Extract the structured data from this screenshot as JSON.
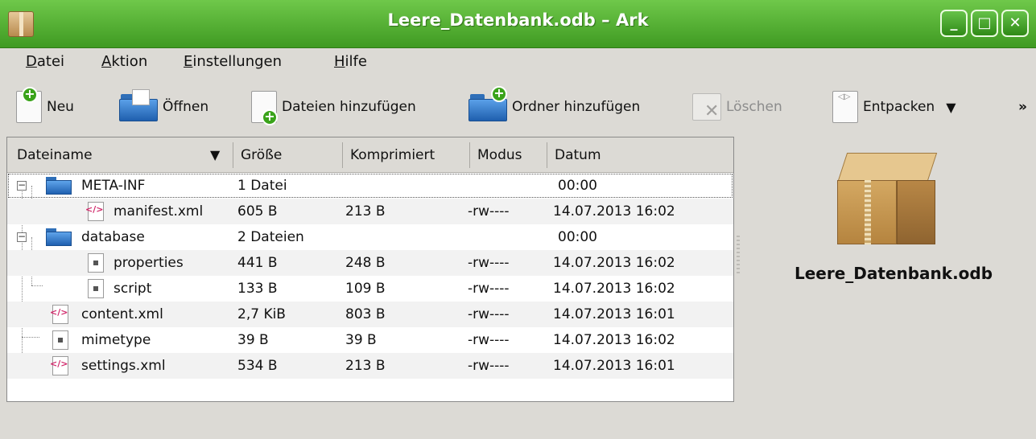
{
  "window": {
    "title": "Leere_Datenbank.odb – Ark",
    "icon": "ark-package-icon",
    "buttons": [
      "minimize-button",
      "maximize-button",
      "close-button"
    ]
  },
  "menubar": {
    "items": [
      {
        "label": "Datei",
        "mnemonic": "D",
        "rest": "atei"
      },
      {
        "label": "Aktion",
        "mnemonic": "A",
        "rest": "ktion"
      },
      {
        "label": "Einstellungen",
        "mnemonic": "E",
        "rest": "instellungen"
      },
      {
        "label": "Hilfe",
        "mnemonic": "H",
        "rest": "ilfe"
      }
    ]
  },
  "toolbar": {
    "neu": "Neu",
    "oeffnen": "Öffnen",
    "dateien_hinzufuegen": "Dateien hinzufügen",
    "ordner_hinzufuegen": "Ordner hinzufügen",
    "loeschen": "Löschen",
    "entpacken": "Entpacken",
    "more": "»"
  },
  "table": {
    "columns": [
      "Dateiname",
      "Größe",
      "Komprimiert",
      "Modus",
      "Datum"
    ],
    "rows": [
      {
        "name": "META-INF",
        "size": "1 Datei",
        "compressed": "",
        "mode": "",
        "date": "00:00",
        "type": "folder"
      },
      {
        "name": "manifest.xml",
        "size": "605 B",
        "compressed": "213 B",
        "mode": "-rw----",
        "date": "14.07.2013 16:02",
        "type": "xml"
      },
      {
        "name": "database",
        "size": "2 Dateien",
        "compressed": "",
        "mode": "",
        "date": "00:00",
        "type": "folder"
      },
      {
        "name": "properties",
        "size": "441 B",
        "compressed": "248 B",
        "mode": "-rw----",
        "date": "14.07.2013 16:02",
        "type": "bin"
      },
      {
        "name": "script",
        "size": "133 B",
        "compressed": "109 B",
        "mode": "-rw----",
        "date": "14.07.2013 16:02",
        "type": "bin"
      },
      {
        "name": "content.xml",
        "size": "2,7 KiB",
        "compressed": "803 B",
        "mode": "-rw----",
        "date": "14.07.2013 16:01",
        "type": "xml"
      },
      {
        "name": "mimetype",
        "size": "39 B",
        "compressed": "39 B",
        "mode": "-rw----",
        "date": "14.07.2013 16:02",
        "type": "bin"
      },
      {
        "name": "settings.xml",
        "size": "534 B",
        "compressed": "213 B",
        "mode": "-rw----",
        "date": "14.07.2013 16:01",
        "type": "xml"
      }
    ]
  },
  "info_panel": {
    "archive_name": "Leere_Datenbank.odb"
  },
  "colors": {
    "titlebar": "#4fae2e",
    "folder": "#2f6fb8",
    "xml_icon": "#d0286a"
  }
}
